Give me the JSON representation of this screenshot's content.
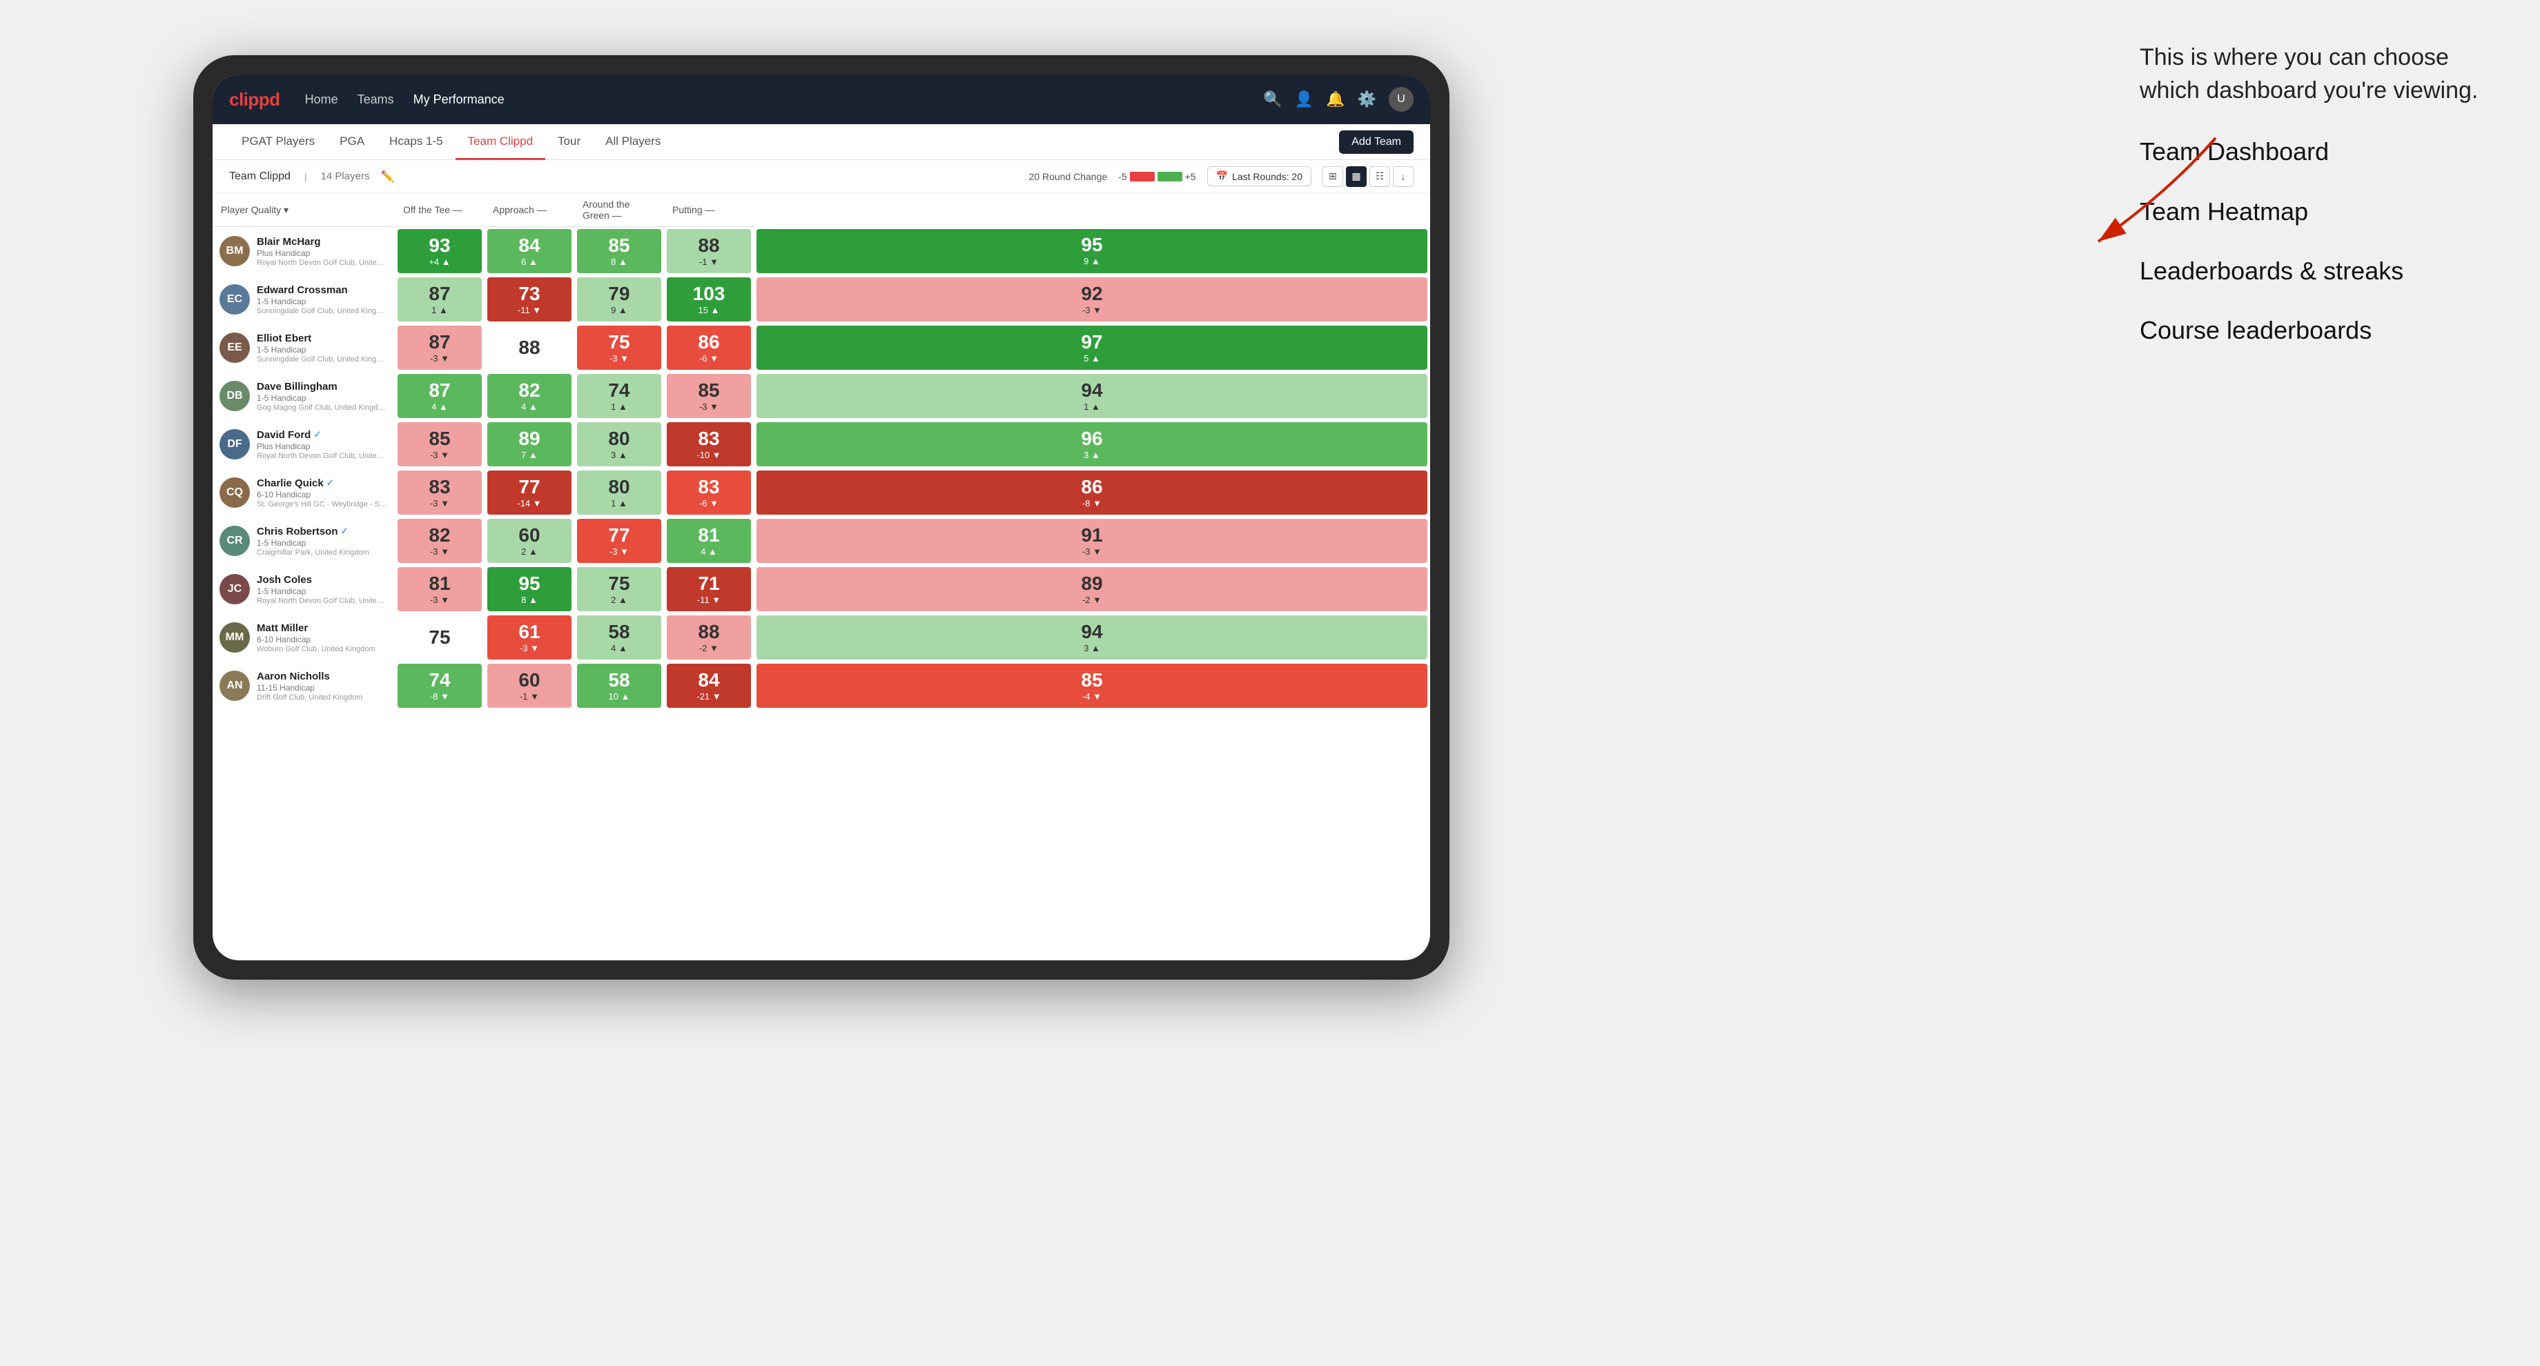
{
  "annotation": {
    "intro_text": "This is where you can choose which dashboard you're viewing.",
    "items": [
      "Team Dashboard",
      "Team Heatmap",
      "Leaderboards & streaks",
      "Course leaderboards"
    ]
  },
  "nav": {
    "logo": "clippd",
    "links": [
      "Home",
      "Teams",
      "My Performance"
    ],
    "active_link": "My Performance",
    "icons": [
      "search",
      "person",
      "bell",
      "settings",
      "avatar"
    ]
  },
  "tabs": {
    "items": [
      "PGAT Players",
      "PGA",
      "Hcaps 1-5",
      "Team Clippd",
      "Tour",
      "All Players"
    ],
    "active": "Team Clippd",
    "add_button": "Add Team"
  },
  "toolbar": {
    "team_name": "Team Clippd",
    "player_count": "14 Players",
    "round_change_label": "20 Round Change",
    "range_low": "-5",
    "range_high": "+5",
    "last_rounds_label": "Last Rounds:",
    "last_rounds_value": "20"
  },
  "table": {
    "columns": {
      "player": "Player Quality",
      "off_tee": "Off the Tee —",
      "approach": "Approach —",
      "around_green": "Around the Green —",
      "putting": "Putting —"
    },
    "players": [
      {
        "name": "Blair McHarg",
        "handicap": "Plus Handicap",
        "club": "Royal North Devon Golf Club, United Kingdom",
        "verified": false,
        "initials": "BM",
        "avatar_color": "#8B6F4E",
        "scores": {
          "quality": {
            "value": 93,
            "change": "+4",
            "dir": "up",
            "bg": "green-dark"
          },
          "off_tee": {
            "value": 84,
            "change": "6",
            "dir": "up",
            "bg": "green-mid"
          },
          "approach": {
            "value": 85,
            "change": "8",
            "dir": "up",
            "bg": "green-mid"
          },
          "around_green": {
            "value": 88,
            "change": "-1",
            "dir": "down",
            "bg": "green-light"
          },
          "putting": {
            "value": 95,
            "change": "9",
            "dir": "up",
            "bg": "green-dark"
          }
        }
      },
      {
        "name": "Edward Crossman",
        "handicap": "1-5 Handicap",
        "club": "Sunningdale Golf Club, United Kingdom",
        "verified": false,
        "initials": "EC",
        "avatar_color": "#5a7a9a",
        "scores": {
          "quality": {
            "value": 87,
            "change": "1",
            "dir": "up",
            "bg": "green-light"
          },
          "off_tee": {
            "value": 73,
            "change": "-11",
            "dir": "down",
            "bg": "red-dark"
          },
          "approach": {
            "value": 79,
            "change": "9",
            "dir": "up",
            "bg": "green-light"
          },
          "around_green": {
            "value": 103,
            "change": "15",
            "dir": "up",
            "bg": "green-dark"
          },
          "putting": {
            "value": 92,
            "change": "-3",
            "dir": "down",
            "bg": "red-light"
          }
        }
      },
      {
        "name": "Elliot Ebert",
        "handicap": "1-5 Handicap",
        "club": "Sunningdale Golf Club, United Kingdom",
        "verified": false,
        "initials": "EE",
        "avatar_color": "#7a5a4a",
        "scores": {
          "quality": {
            "value": 87,
            "change": "-3",
            "dir": "down",
            "bg": "red-light"
          },
          "off_tee": {
            "value": 88,
            "change": "",
            "dir": "none",
            "bg": "white"
          },
          "approach": {
            "value": 75,
            "change": "-3",
            "dir": "down",
            "bg": "red-mid"
          },
          "around_green": {
            "value": 86,
            "change": "-6",
            "dir": "down",
            "bg": "red-mid"
          },
          "putting": {
            "value": 97,
            "change": "5",
            "dir": "up",
            "bg": "green-dark"
          }
        }
      },
      {
        "name": "Dave Billingham",
        "handicap": "1-5 Handicap",
        "club": "Gog Magog Golf Club, United Kingdom",
        "verified": false,
        "initials": "DB",
        "avatar_color": "#6a8a6a",
        "scores": {
          "quality": {
            "value": 87,
            "change": "4",
            "dir": "up",
            "bg": "green-mid"
          },
          "off_tee": {
            "value": 82,
            "change": "4",
            "dir": "up",
            "bg": "green-mid"
          },
          "approach": {
            "value": 74,
            "change": "1",
            "dir": "up",
            "bg": "green-light"
          },
          "around_green": {
            "value": 85,
            "change": "-3",
            "dir": "down",
            "bg": "red-light"
          },
          "putting": {
            "value": 94,
            "change": "1",
            "dir": "up",
            "bg": "green-light"
          }
        }
      },
      {
        "name": "David Ford",
        "handicap": "Plus Handicap",
        "club": "Royal North Devon Golf Club, United Kingdom",
        "verified": true,
        "initials": "DF",
        "avatar_color": "#4a6a8a",
        "scores": {
          "quality": {
            "value": 85,
            "change": "-3",
            "dir": "down",
            "bg": "red-light"
          },
          "off_tee": {
            "value": 89,
            "change": "7",
            "dir": "up",
            "bg": "green-mid"
          },
          "approach": {
            "value": 80,
            "change": "3",
            "dir": "up",
            "bg": "green-light"
          },
          "around_green": {
            "value": 83,
            "change": "-10",
            "dir": "down",
            "bg": "red-dark"
          },
          "putting": {
            "value": 96,
            "change": "3",
            "dir": "up",
            "bg": "green-mid"
          }
        }
      },
      {
        "name": "Charlie Quick",
        "handicap": "6-10 Handicap",
        "club": "St. George's Hill GC - Weybridge - Surrey, Uni...",
        "verified": true,
        "initials": "CQ",
        "avatar_color": "#8a6a4a",
        "scores": {
          "quality": {
            "value": 83,
            "change": "-3",
            "dir": "down",
            "bg": "red-light"
          },
          "off_tee": {
            "value": 77,
            "change": "-14",
            "dir": "down",
            "bg": "red-dark"
          },
          "approach": {
            "value": 80,
            "change": "1",
            "dir": "up",
            "bg": "green-light"
          },
          "around_green": {
            "value": 83,
            "change": "-6",
            "dir": "down",
            "bg": "red-mid"
          },
          "putting": {
            "value": 86,
            "change": "-8",
            "dir": "down",
            "bg": "red-dark"
          }
        }
      },
      {
        "name": "Chris Robertson",
        "handicap": "1-5 Handicap",
        "club": "Craigmillar Park, United Kingdom",
        "verified": true,
        "initials": "CR",
        "avatar_color": "#5a8a7a",
        "scores": {
          "quality": {
            "value": 82,
            "change": "-3",
            "dir": "down",
            "bg": "red-light"
          },
          "off_tee": {
            "value": 60,
            "change": "2",
            "dir": "up",
            "bg": "green-light"
          },
          "approach": {
            "value": 77,
            "change": "-3",
            "dir": "down",
            "bg": "red-mid"
          },
          "around_green": {
            "value": 81,
            "change": "4",
            "dir": "up",
            "bg": "green-mid"
          },
          "putting": {
            "value": 91,
            "change": "-3",
            "dir": "down",
            "bg": "red-light"
          }
        }
      },
      {
        "name": "Josh Coles",
        "handicap": "1-5 Handicap",
        "club": "Royal North Devon Golf Club, United Kingdom",
        "verified": false,
        "initials": "JC",
        "avatar_color": "#7a4a4a",
        "scores": {
          "quality": {
            "value": 81,
            "change": "-3",
            "dir": "down",
            "bg": "red-light"
          },
          "off_tee": {
            "value": 95,
            "change": "8",
            "dir": "up",
            "bg": "green-dark"
          },
          "approach": {
            "value": 75,
            "change": "2",
            "dir": "up",
            "bg": "green-light"
          },
          "around_green": {
            "value": 71,
            "change": "-11",
            "dir": "down",
            "bg": "red-dark"
          },
          "putting": {
            "value": 89,
            "change": "-2",
            "dir": "down",
            "bg": "red-light"
          }
        }
      },
      {
        "name": "Matt Miller",
        "handicap": "6-10 Handicap",
        "club": "Woburn Golf Club, United Kingdom",
        "verified": false,
        "initials": "MM",
        "avatar_color": "#6a6a4a",
        "scores": {
          "quality": {
            "value": 75,
            "change": "",
            "dir": "none",
            "bg": "white"
          },
          "off_tee": {
            "value": 61,
            "change": "-3",
            "dir": "down",
            "bg": "red-mid"
          },
          "approach": {
            "value": 58,
            "change": "4",
            "dir": "up",
            "bg": "green-light"
          },
          "around_green": {
            "value": 88,
            "change": "-2",
            "dir": "down",
            "bg": "red-light"
          },
          "putting": {
            "value": 94,
            "change": "3",
            "dir": "up",
            "bg": "green-light"
          }
        }
      },
      {
        "name": "Aaron Nicholls",
        "handicap": "11-15 Handicap",
        "club": "Drift Golf Club, United Kingdom",
        "verified": false,
        "initials": "AN",
        "avatar_color": "#8a7a5a",
        "scores": {
          "quality": {
            "value": 74,
            "change": "-8",
            "dir": "down",
            "bg": "green-mid"
          },
          "off_tee": {
            "value": 60,
            "change": "-1",
            "dir": "down",
            "bg": "red-light"
          },
          "approach": {
            "value": 58,
            "change": "10",
            "dir": "up",
            "bg": "green-mid"
          },
          "around_green": {
            "value": 84,
            "change": "-21",
            "dir": "down",
            "bg": "red-dark"
          },
          "putting": {
            "value": 85,
            "change": "-4",
            "dir": "down",
            "bg": "red-mid"
          }
        }
      }
    ]
  },
  "colors": {
    "nav_bg": "#1a2332",
    "brand_red": "#e84040",
    "green_dark": "#2e9e3a",
    "green_mid": "#5cb85c",
    "green_light": "#a8d8a8",
    "red_dark": "#c0392b",
    "red_mid": "#e74c3c",
    "red_light": "#f0a0a0"
  }
}
